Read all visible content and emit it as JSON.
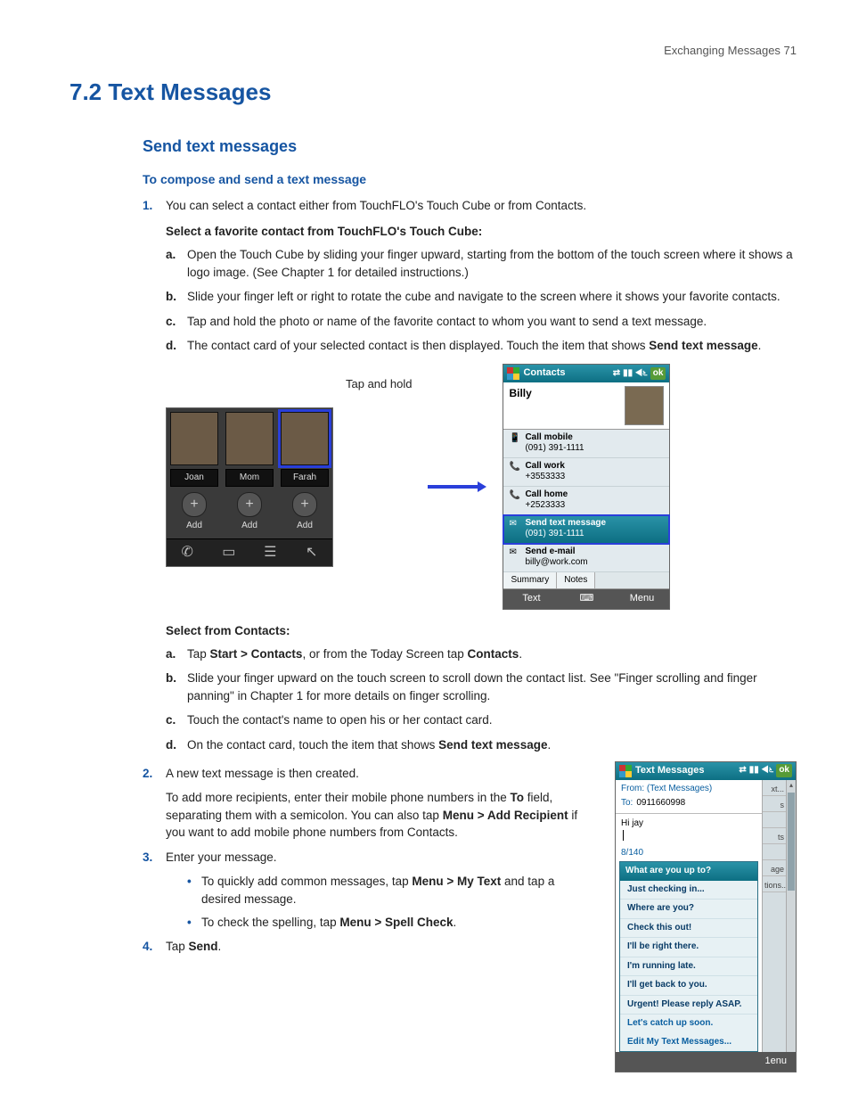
{
  "runHead": "Exchanging Messages  71",
  "h1": "7.2  Text Messages",
  "h2": "Send text messages",
  "h3": "To compose and send a text message",
  "step1": "You can select a contact either from TouchFLO's Touch Cube or from Contacts.",
  "sub1title": "Select a favorite contact from TouchFLO's Touch Cube:",
  "s1a": "Open the Touch Cube by sliding your finger upward, starting from the bottom of the touch screen where it shows a logo image. (See Chapter 1 for detailed instructions.)",
  "s1b": "Slide your finger left or right to rotate the cube and navigate to the screen where it shows your favorite contacts.",
  "s1c": "Tap and hold the photo or name of the favorite contact to whom you want to send a text message.",
  "s1d_pre": "The contact card of your selected contact is then displayed. Touch the item that shows ",
  "s1d_bold": "Send text message",
  "s1d_post": ".",
  "figCap": "Tap and hold",
  "cube": {
    "names": [
      "Joan",
      "Mom",
      "Farah"
    ],
    "add": "Add"
  },
  "contactCard": {
    "title": "Contacts",
    "ok": "ok",
    "name": "Billy",
    "rows": [
      {
        "icon": "📱",
        "main": "Call mobile",
        "sub": "(091) 391-1111"
      },
      {
        "icon": "📞",
        "main": "Call work",
        "sub": "+3553333"
      },
      {
        "icon": "📞",
        "main": "Call home",
        "sub": "+2523333"
      },
      {
        "icon": "✉",
        "main": "Send text message",
        "sub": "(091) 391-1111",
        "sel": true
      },
      {
        "icon": "✉",
        "main": "Send e-mail",
        "sub": "billy@work.com"
      }
    ],
    "tabs": [
      "Summary",
      "Notes"
    ],
    "soft": [
      "Text",
      "",
      "Menu"
    ]
  },
  "sub2title": "Select from Contacts:",
  "s2a_pre": "Tap ",
  "s2a_b1": "Start > Contacts",
  "s2a_mid": ", or from the Today Screen tap ",
  "s2a_b2": "Contacts",
  "s2a_post": ".",
  "s2b": "Slide your finger upward on the touch screen to scroll down the contact list. See \"Finger scrolling and finger panning\" in Chapter 1 for more details on finger scrolling.",
  "s2c": "Touch the contact's name to open his or her contact card.",
  "s2d_pre": "On the contact card, touch the item that shows ",
  "s2d_b": "Send text message",
  "s2d_post": ".",
  "step2a": "A new text message is then created.",
  "step2b_pre": "To add more recipients, enter their mobile phone numbers in the ",
  "step2b_b1": "To",
  "step2b_mid": " field, separating them with a semicolon. You can also tap ",
  "step2b_b2": "Menu > Add Recipient",
  "step2b_post": " if you want to add mobile phone numbers from Contacts.",
  "step3": "Enter your message.",
  "bullet1_pre": "To quickly add common messages, tap ",
  "bullet1_b": "Menu > My Text",
  "bullet1_post": " and tap a desired message.",
  "bullet2_pre": "To check the spelling, tap ",
  "bullet2_b": "Menu > Spell Check",
  "bullet2_post": ".",
  "step4_pre": "Tap ",
  "step4_b": "Send",
  "step4_post": ".",
  "msgScreen": {
    "title": "Text Messages",
    "ok": "ok",
    "from": "From: (Text Messages)",
    "toLabel": "To:",
    "toNum": "0911660998",
    "body": "Hi jay",
    "count": "8/140",
    "menuHead": "What are you up to?",
    "items": [
      "Just checking in...",
      "Where are you?",
      "Check this out!",
      "I'll be right there.",
      "I'm running late.",
      "I'll get back to you.",
      "Urgent! Please reply ASAP.",
      "Let's catch up soon."
    ],
    "edit": "Edit My Text Messages...",
    "side": [
      "xt...",
      "s",
      "",
      "ts",
      "",
      "age",
      "tions..."
    ],
    "softRight": "1enu"
  }
}
